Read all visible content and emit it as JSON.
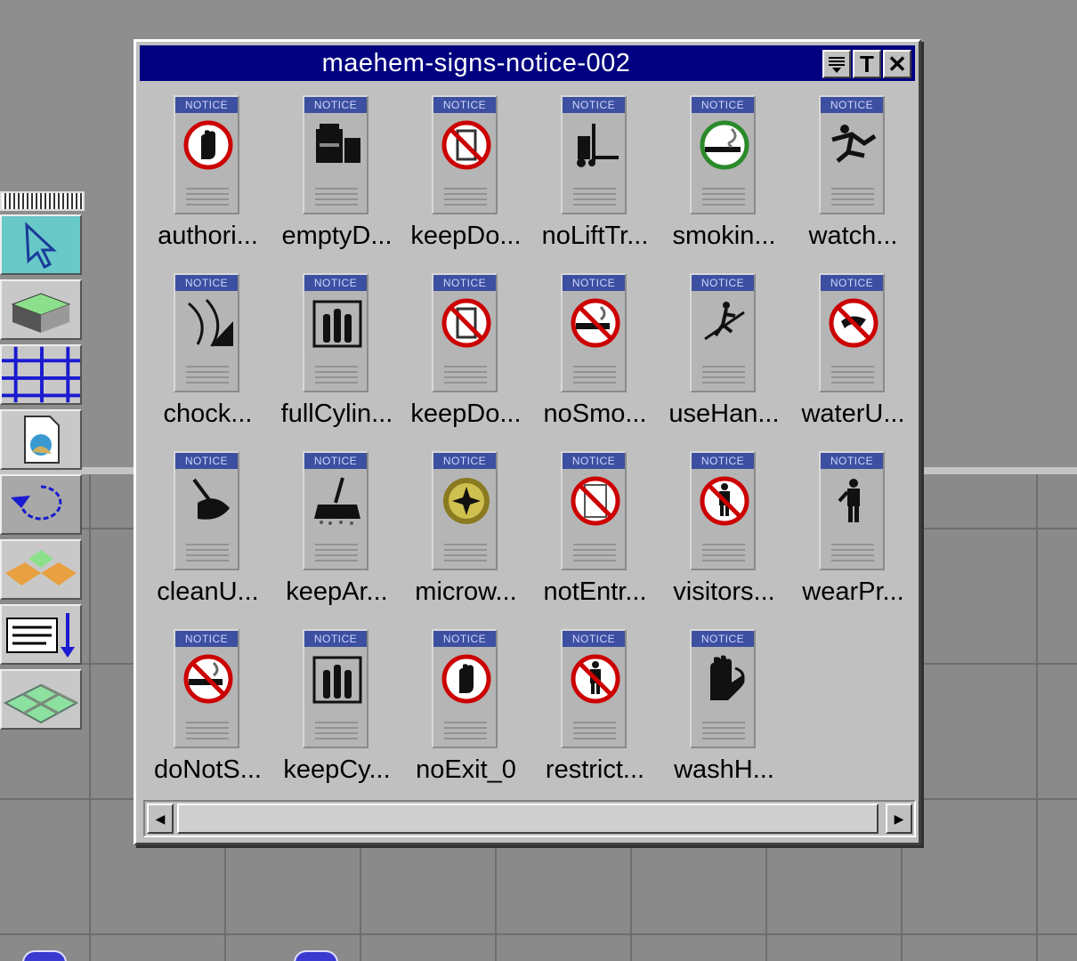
{
  "window": {
    "title": "maehem-signs-notice-002",
    "pin_glyph": "T",
    "close_glyph": "✕"
  },
  "sign_header": "NOTICE",
  "items": [
    {
      "label": "authori...",
      "icon": "hand-stop-icon"
    },
    {
      "label": "emptyD...",
      "icon": "dumpster-icon"
    },
    {
      "label": "keepDo...",
      "icon": "no-door-icon"
    },
    {
      "label": "noLiftTr...",
      "icon": "forklift-icon"
    },
    {
      "label": "smokin...",
      "icon": "smoking-area-icon"
    },
    {
      "label": "watch...",
      "icon": "slip-hazard-icon"
    },
    {
      "label": "chock...",
      "icon": "wheel-chock-icon"
    },
    {
      "label": "fullCylin...",
      "icon": "gas-cylinders-icon"
    },
    {
      "label": "keepDo...",
      "icon": "no-door-icon"
    },
    {
      "label": "noSmo...",
      "icon": "no-smoking-icon"
    },
    {
      "label": "useHan...",
      "icon": "handrail-icon"
    },
    {
      "label": "waterU...",
      "icon": "no-water-icon"
    },
    {
      "label": "cleanU...",
      "icon": "mop-icon"
    },
    {
      "label": "keepAr...",
      "icon": "broom-icon"
    },
    {
      "label": "microw...",
      "icon": "microwave-hazard-icon"
    },
    {
      "label": "notEntr...",
      "icon": "no-entry-door-icon"
    },
    {
      "label": "visitors...",
      "icon": "no-visitors-icon"
    },
    {
      "label": "wearPr...",
      "icon": "person-ppe-icon"
    },
    {
      "label": "doNotS...",
      "icon": "no-smoking-icon"
    },
    {
      "label": "keepCy...",
      "icon": "gas-cylinders-icon"
    },
    {
      "label": "noExit_0",
      "icon": "no-exit-hand-icon"
    },
    {
      "label": "restrict...",
      "icon": "no-visitors-icon"
    },
    {
      "label": "washH...",
      "icon": "wash-hands-icon"
    }
  ],
  "scrollbar": {
    "left_arrow": "◀",
    "right_arrow": "▶"
  }
}
